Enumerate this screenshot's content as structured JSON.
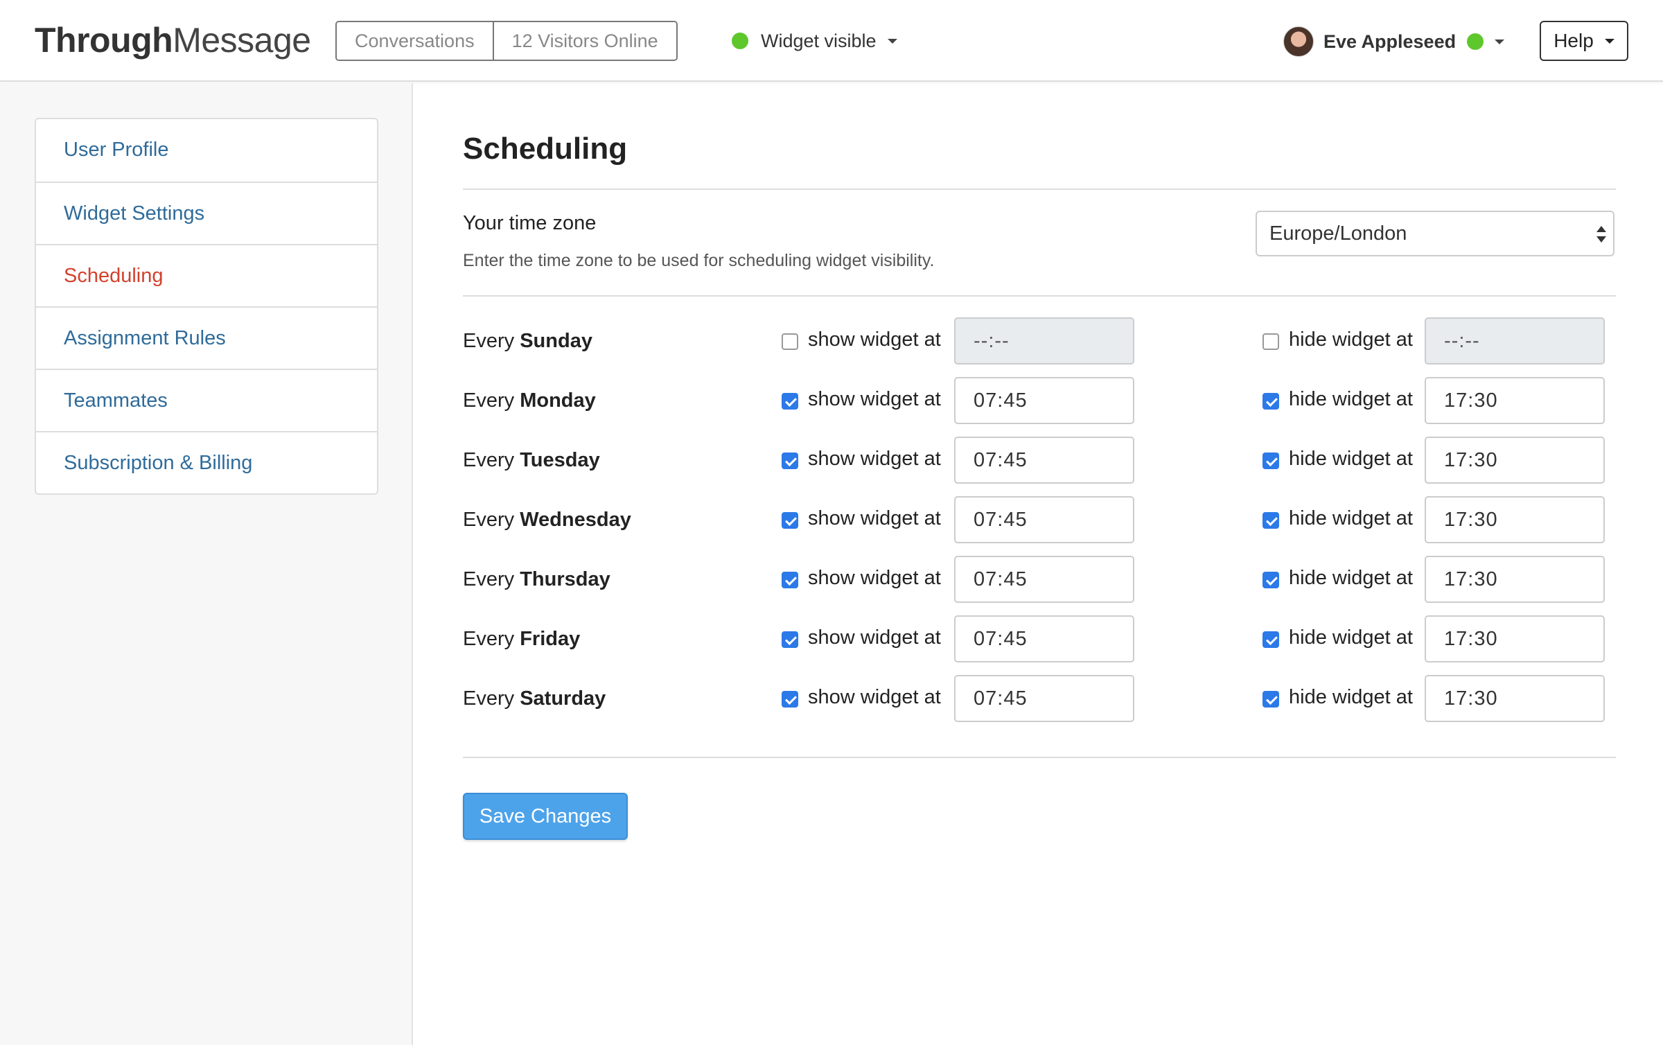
{
  "header": {
    "brand_bold": "Through",
    "brand_light": "Message",
    "conversations": "Conversations",
    "visitors": "12 Visitors Online",
    "widget_status": "Widget visible",
    "user_name": "Eve Appleseed",
    "help": "Help",
    "status_color": "#5dc72c"
  },
  "sidebar": {
    "items": [
      {
        "label": "User Profile"
      },
      {
        "label": "Widget Settings"
      },
      {
        "label": "Scheduling"
      },
      {
        "label": "Assignment Rules"
      },
      {
        "label": "Teammates"
      },
      {
        "label": "Subscription & Billing"
      }
    ],
    "active": "Scheduling"
  },
  "main": {
    "title": "Scheduling",
    "tz_label": "Your time zone",
    "tz_help": "Enter the time zone to be used for scheduling widget visibility.",
    "tz_value": "Europe/London",
    "every": "Every",
    "show_label": "show widget at",
    "hide_label": "hide widget at",
    "days": [
      {
        "day": "Sunday",
        "show_on": false,
        "show_time": "--:--",
        "hide_on": false,
        "hide_time": "--:--"
      },
      {
        "day": "Monday",
        "show_on": true,
        "show_time": "07:45",
        "hide_on": true,
        "hide_time": "17:30"
      },
      {
        "day": "Tuesday",
        "show_on": true,
        "show_time": "07:45",
        "hide_on": true,
        "hide_time": "17:30"
      },
      {
        "day": "Wednesday",
        "show_on": true,
        "show_time": "07:45",
        "hide_on": true,
        "hide_time": "17:30"
      },
      {
        "day": "Thursday",
        "show_on": true,
        "show_time": "07:45",
        "hide_on": true,
        "hide_time": "17:30"
      },
      {
        "day": "Friday",
        "show_on": true,
        "show_time": "07:45",
        "hide_on": true,
        "hide_time": "17:30"
      },
      {
        "day": "Saturday",
        "show_on": true,
        "show_time": "07:45",
        "hide_on": true,
        "hide_time": "17:30"
      }
    ],
    "save": "Save Changes"
  },
  "colors": {
    "accent": "#2c79e8",
    "link": "#2f6b9a",
    "active_link": "#d3412c",
    "save_button": "#4da3ea"
  }
}
